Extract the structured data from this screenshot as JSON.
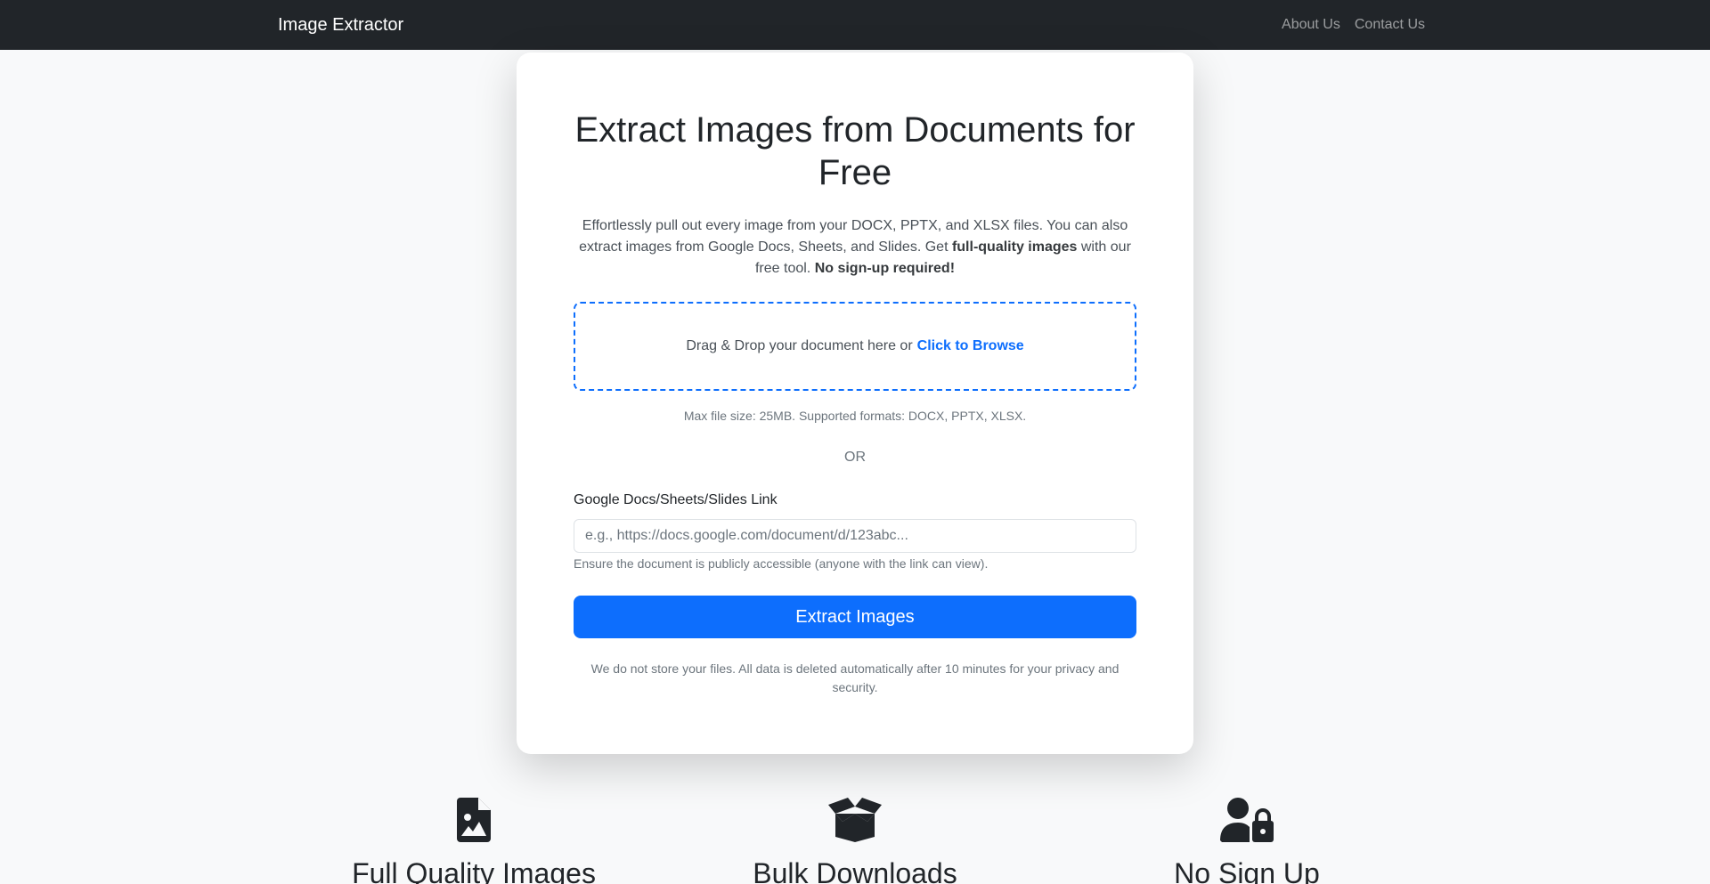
{
  "nav": {
    "brand": "Image Extractor",
    "links": [
      "About Us",
      "Contact Us"
    ]
  },
  "hero": {
    "title": "Extract Images from Documents for Free",
    "lead_part1": "Effortlessly pull out every image from your DOCX, PPTX, and XLSX files. You can also extract images from Google Docs, Sheets, and Slides. Get ",
    "lead_bold1": "full-quality images",
    "lead_part2": " with our free tool. ",
    "lead_bold2": "No sign-up required!"
  },
  "upload": {
    "drop_text": "Drag & Drop your document here or",
    "browse_text": "Click to Browse",
    "hint": "Max file size: 25MB. Supported formats: DOCX, PPTX, XLSX."
  },
  "or_text": "OR",
  "link_field": {
    "label": "Google Docs/Sheets/Slides Link",
    "placeholder": "e.g., https://docs.google.com/document/d/123abc...",
    "value": "",
    "help": "Ensure the document is publicly accessible (anyone with the link can view)."
  },
  "extract_button": "Extract Images",
  "privacy_note": "We do not store your files. All data is deleted automatically after 10 minutes for your privacy and security.",
  "features": [
    {
      "title": "Full Quality Images",
      "icon": "file-image-icon"
    },
    {
      "title": "Bulk Downloads",
      "icon": "box-open-icon"
    },
    {
      "title": "No Sign Up",
      "icon": "user-lock-icon"
    }
  ],
  "colors": {
    "navbar": "#212529",
    "primary": "#0d6efd",
    "background": "#f8f9fa"
  }
}
